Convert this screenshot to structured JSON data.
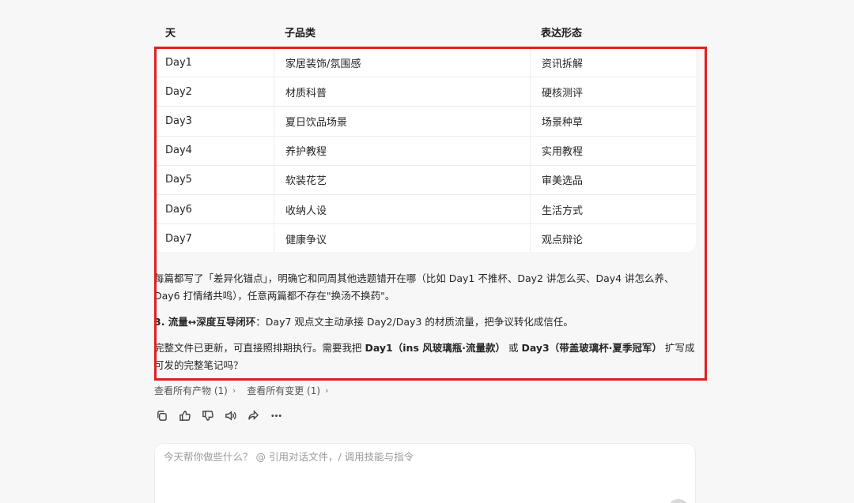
{
  "table": {
    "headers": {
      "day": "天",
      "category": "子品类",
      "form": "表达形态"
    },
    "rows": [
      {
        "day": "Day1",
        "category": "家居装饰/氛围感",
        "form": "资讯拆解"
      },
      {
        "day": "Day2",
        "category": "材质科普",
        "form": "硬核测评"
      },
      {
        "day": "Day3",
        "category": "夏日饮品场景",
        "form": "场景种草"
      },
      {
        "day": "Day4",
        "category": "养护教程",
        "form": "实用教程"
      },
      {
        "day": "Day5",
        "category": "软装花艺",
        "form": "审美选品"
      },
      {
        "day": "Day6",
        "category": "收纳人设",
        "form": "生活方式"
      },
      {
        "day": "Day7",
        "category": "健康争议",
        "form": "观点辩论"
      }
    ]
  },
  "paragraphs": {
    "p1": "每篇都写了「差异化锚点」，明确它和同周其他选题错开在哪（比如 Day1 不推杯、Day2 讲怎么买、Day4 讲怎么养、Day6 打情绪共鸣），任意两篇都不存在\"换汤不换药\"。",
    "p2_bold": "3. 流量↔深度互导闭环",
    "p2_rest": "：Day7 观点文主动承接 Day2/Day3 的材质流量，把争议转化成信任。",
    "p3_a": "完整文件已更新，可直接照排期执行。需要我把 ",
    "p3_b": "Day1（ins 风玻璃瓶·流量款）",
    "p3_c": " 或 ",
    "p3_d": "Day3（带盖玻璃杯·夏季冠军）",
    "p3_e": " 扩写成可发的完整笔记吗？"
  },
  "links": {
    "artifacts": "查看所有产物 (1)",
    "changes": "查看所有变更 (1)"
  },
  "actions": [
    "copy-icon",
    "thumbs-up-icon",
    "thumbs-down-icon",
    "speaker-icon",
    "share-icon",
    "more-icon"
  ],
  "composer": {
    "placeholder": "今天帮你做些什么？ @ 引用对话文件，/ 调用技能与指令"
  },
  "colors": {
    "highlight": "#e01f1f",
    "background": "#f7f7f8"
  }
}
